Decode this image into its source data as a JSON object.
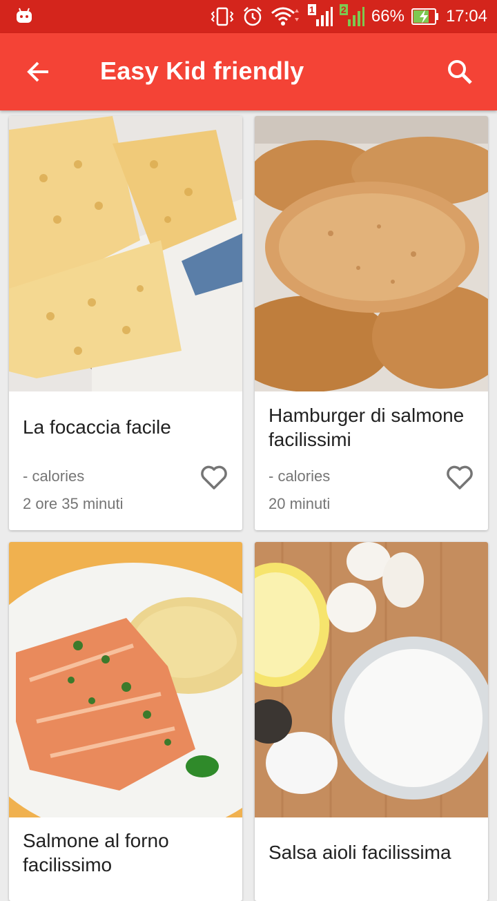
{
  "status_bar": {
    "battery": "66%",
    "time": "17:04",
    "sim1": "1",
    "sim2": "2"
  },
  "app_bar": {
    "title": "Easy Kid friendly"
  },
  "recipes": [
    {
      "title": "La focaccia facile",
      "calories": "- calories",
      "time": "2 ore 35 minuti"
    },
    {
      "title": "Hamburger di salmone facilissimi",
      "calories": "- calories",
      "time": "20 minuti"
    },
    {
      "title": "Salmone al forno facilissimo",
      "calories": "",
      "time": ""
    },
    {
      "title": "Salsa aioli facilissima",
      "calories": "",
      "time": ""
    }
  ],
  "colors": {
    "status_bar": "#d4251c",
    "app_bar": "#f44336",
    "background": "#ececec"
  },
  "icons": {
    "back": "arrow-left-icon",
    "search": "search-icon",
    "favorite": "heart-outline-icon"
  }
}
